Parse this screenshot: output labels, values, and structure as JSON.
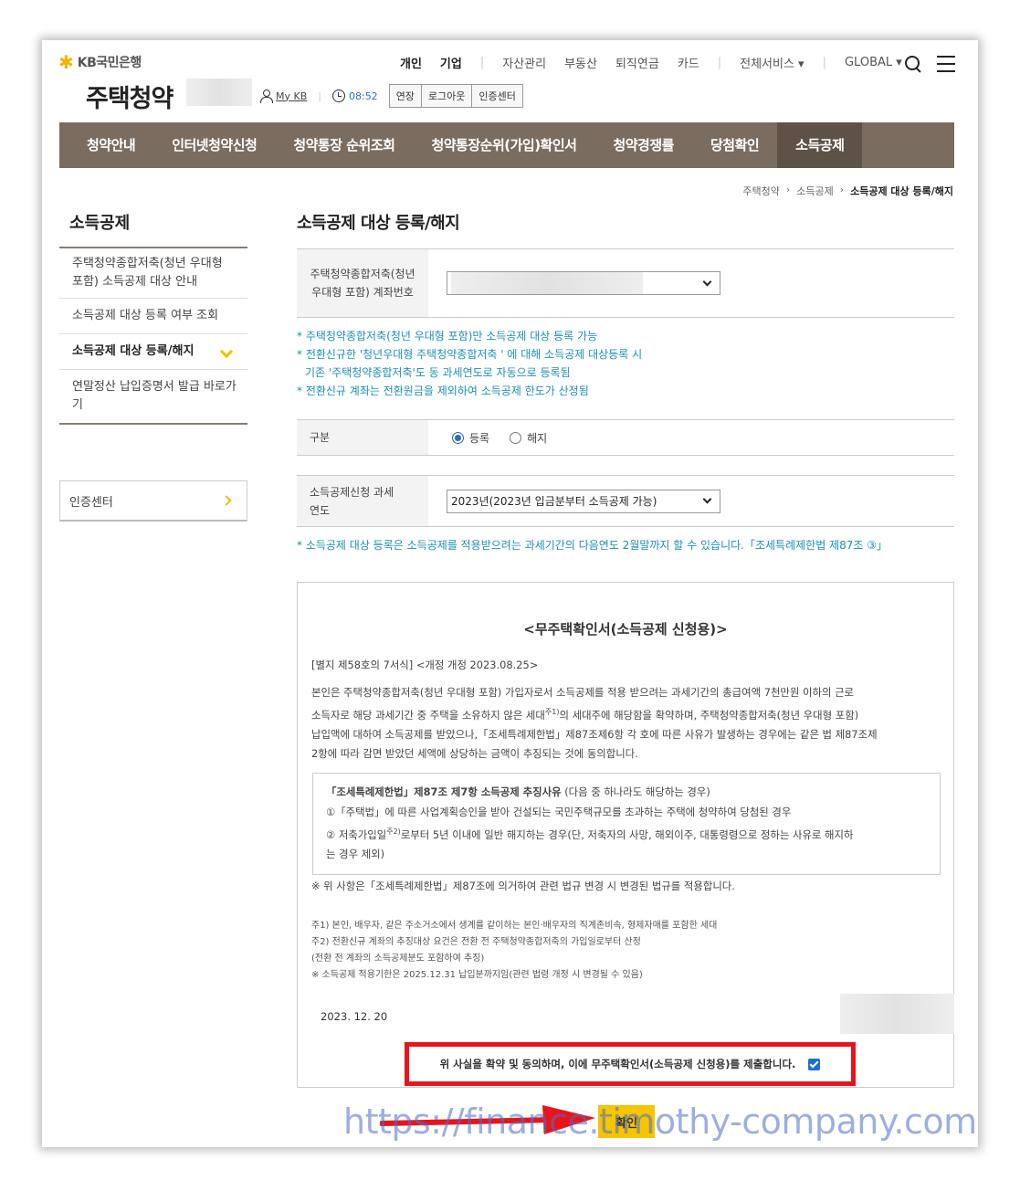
{
  "header": {
    "logo_star": "✱",
    "logo_text": "KB국민은행",
    "site_title": "주택청약",
    "top_nav": [
      "개인",
      "기업",
      "자산관리",
      "부동산",
      "퇴직연금",
      "카드",
      "전체서비스 ▾",
      "GLOBAL ▾"
    ],
    "my_kb": "My KB",
    "session_time": "08:52",
    "extend_button": "연장",
    "logout_button": "로그아웃",
    "cert_center_button": "인증센터"
  },
  "main_nav": [
    "청약안내",
    "인터넷청약신청",
    "청약통장 순위조회",
    "청약통장순위(가입)확인서",
    "청약경쟁률",
    "당첨확인",
    "소득공제"
  ],
  "breadcrumb": [
    "주택청약",
    "소득공제",
    "소득공제 대상 등록/해지"
  ],
  "breadcrumb_sep": "›",
  "sidebar": {
    "title": "소득공제",
    "items": [
      "주택청약종합저축(청년 우대형 포함) 소득공제 대상 안내",
      "소득공제 대상 등록 여부 조회",
      "소득공제 대상 등록/해지",
      "연말정산 납입증명서 발급 바로가기"
    ],
    "cert_center": "인증센터"
  },
  "content": {
    "page_title": "소득공제 대상 등록/해지",
    "account_label": "주택청약종합저축(청년 우대형 포함) 계좌번호",
    "notes": [
      "* 주택청약종합저축(청년 우대형 포함)만 소득공제 대상 등록 가능",
      "* 전환신규한 '청년우대형 주택청약종합저축 ' 에 대해 소득공제 대상등록 시",
      "기존 '주택청약종합저축'도 동 과세연도로 자동으로 등록됨",
      "* 전환신규 계좌는 전환원금을 제외하여 소득공제 한도가 산정됨"
    ],
    "type_label": "구분",
    "radio_register": "등록",
    "radio_cancel": "해지",
    "year_label": "소득공제신청 과세연도",
    "year_value": "2023년(2023년 입금분부터 소득공제 가능)",
    "note_bottom": "* 소득공제 대상 등록은 소득공제를 적용받으려는 과세기간의 다음연도 2월말까지 할 수 있습니다.「조세특례제한법 제87조 ③」"
  },
  "document": {
    "title": "<무주택확인서(소득공제 신청용)>",
    "form_ref": "[별지 제58호의 7서식] <개정 개정 2023.08.25>",
    "body_1": "본인은 주택청약종합저축(청년 우대형 포함) 가입자로서 소득공제를 적용 받으려는 과세기간의 총급여액 7천만원 이하의 근로",
    "body_2a": "소득자로 해당 과세기간 중 주택을 소유하지 않은 세대",
    "body_2sup": "주1)",
    "body_2b": "의 세대주에 해당함을 확약하며, 주택청약종합저축(청년 우대형 포함)",
    "body_3": "납입액에 대하여 소득공제를 받았으나,「조세특례제한법」제87조제6항 각 호에 따른 사유가 발생하는 경우에는 같은 법 제87조제",
    "body_4": "2항에 따라 감면 받았던 세액에 상당하는 금액이 추징되는 것에 동의합니다.",
    "box_title_bold": "「조세특례제한법」제87조 제7항 소득공제 추징사유",
    "box_title_rest": " (다음 중 하나라도 해당하는 경우)",
    "box_item1": "①「주택법」에 따른 사업계획승인을 받아 건설되는 국민주택규모를 초과하는 주택에 청약하여 당첨된 경우",
    "box_item2a": "② 저축가입일",
    "box_item2sup": "주2)",
    "box_item2b": "로부터 5년 이내에 일반 해지하는 경우(단, 저축자의 사망, 해외이주, 대통령령으로 정하는 사유로 해지하",
    "box_item2c": "는 경우 제외)",
    "law_note": "※ 위 사항은「조세특례제한법」제87조에 의거하여 관련 법규 변경 시 변경된 법규를 적용합니다.",
    "fn1": "주1) 본인, 배우자, 같은 주소거소에서 생계를 같이하는 본인·배우자의 직계존비속, 형제자매를 포함한 세대",
    "fn2": "주2) 전환신규 계좌의 추징대상 요건은 전환 전 주택청약종합저축의 가입일로부터 산정",
    "fn3": "(전환 전 계좌의 소득공제분도 포함하여 추징)",
    "fn4": "※ 소득공제 적용기한은 2025.12.31 납입분까지임(관련 법령 개정 시 변경될 수 있음)",
    "date": "2023. 12. 20",
    "agree_text": "위 사실을 확약 및 동의하며, 이에 무주택확인서(소득공제 신청용)를 제출합니다.",
    "agree_checked": true
  },
  "confirm_button": "확인",
  "watermark": "https://finance.timothy-company.com",
  "colors": {
    "nav_bg": "#7a6d5f",
    "nav_active": "#5e5247",
    "accent_yellow": "#f6c500",
    "note_blue": "#1c8fb5",
    "highlight_red": "#e8141b"
  }
}
